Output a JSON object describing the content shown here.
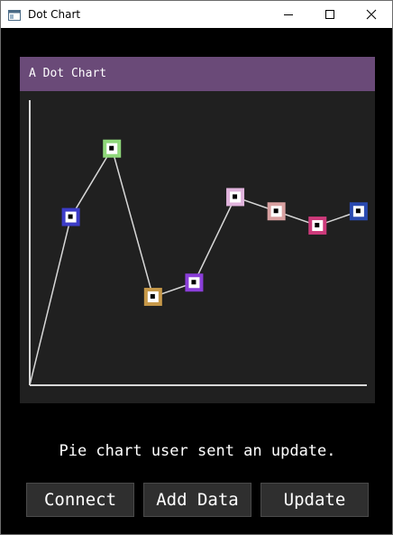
{
  "window": {
    "title": "Dot Chart"
  },
  "icons": {
    "app": "app-window-icon",
    "minimize": "minimize-icon",
    "maximize": "maximize-icon",
    "close": "close-icon"
  },
  "chart": {
    "title": "A Dot Chart"
  },
  "chart_data": {
    "type": "scatter",
    "title": "A Dot Chart",
    "xlabel": "",
    "ylabel": "",
    "grid": false,
    "lines_connect_points": true,
    "x": [
      1,
      2,
      3,
      4,
      5,
      6,
      7,
      8
    ],
    "y": [
      59,
      83,
      31,
      36,
      66,
      61,
      56,
      61
    ],
    "xlim": [
      0,
      8.2
    ],
    "ylim": [
      0,
      100
    ],
    "colors": [
      "#3c3cc8",
      "#8fd87a",
      "#c69848",
      "#8a3ed8",
      "#e0b3dc",
      "#d8a0a0",
      "#cc3a7a",
      "#2a4ab0"
    ]
  },
  "status": {
    "message": "Pie chart user sent an update."
  },
  "buttons": {
    "connect": "Connect",
    "add_data": "Add Data",
    "update": "Update"
  }
}
